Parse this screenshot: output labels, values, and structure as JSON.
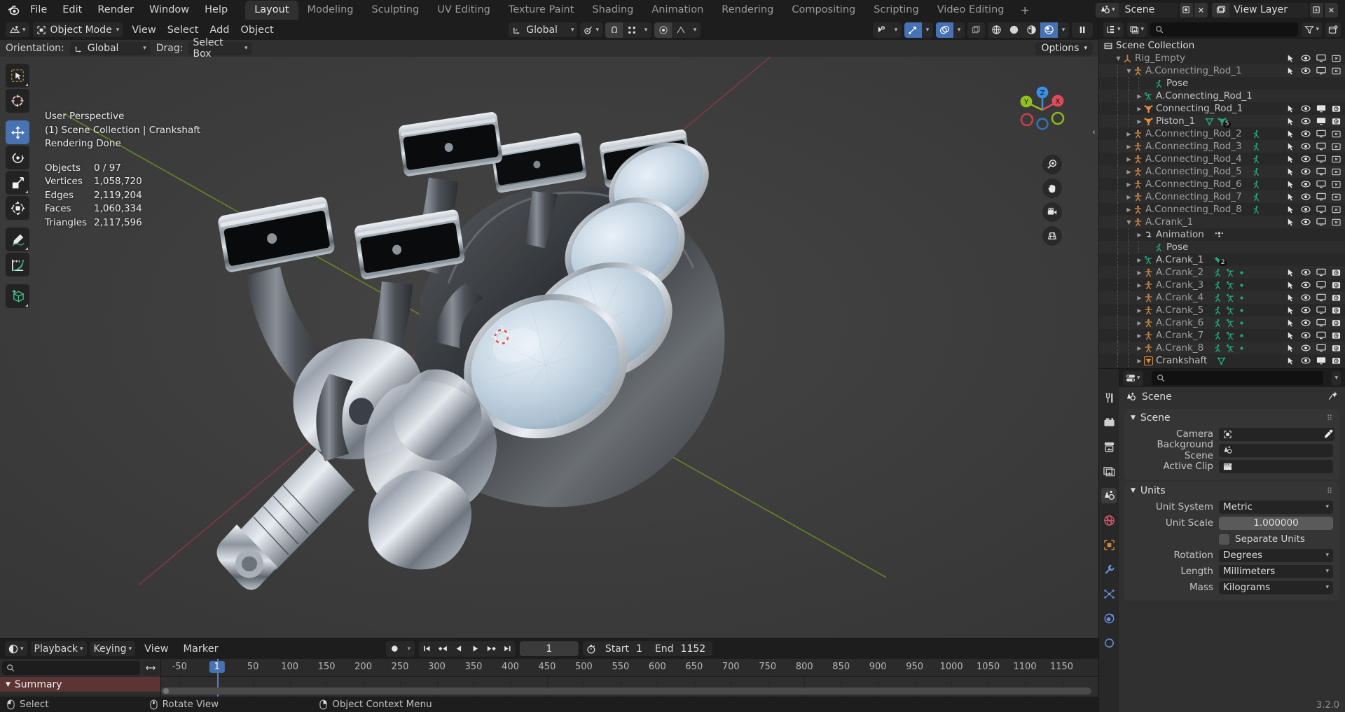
{
  "topbar": {
    "logo_icon": "blender-logo-icon",
    "menus": [
      "File",
      "Edit",
      "Render",
      "Window",
      "Help"
    ],
    "workspace_tabs": [
      {
        "label": "Layout",
        "active": true
      },
      {
        "label": "Modeling",
        "active": false
      },
      {
        "label": "Sculpting",
        "active": false
      },
      {
        "label": "UV Editing",
        "active": false
      },
      {
        "label": "Texture Paint",
        "active": false
      },
      {
        "label": "Shading",
        "active": false
      },
      {
        "label": "Animation",
        "active": false
      },
      {
        "label": "Rendering",
        "active": false
      },
      {
        "label": "Compositing",
        "active": false
      },
      {
        "label": "Scripting",
        "active": false
      },
      {
        "label": "Video Editing",
        "active": false
      }
    ],
    "add_workspace_label": "+",
    "scene_name": "Scene",
    "view_layer_name": "View Layer"
  },
  "viewport_header": {
    "editor_type_icon": "editor-type-3d-viewport-icon",
    "mode": "Object Mode",
    "menus": [
      "View",
      "Select",
      "Add",
      "Object"
    ],
    "transform_orientation": "Global",
    "snap_icon": "snap-magnet-icon",
    "proportional_icon": "proportional-edit-icon",
    "shading_modes": [
      "wireframe",
      "solid",
      "material-preview",
      "rendered"
    ],
    "active_shading": "rendered"
  },
  "tool_settings": {
    "orientation_label": "Orientation:",
    "orientation_value": "Global",
    "drag_label": "Drag:",
    "drag_value": "Select Box",
    "options_label": "Options"
  },
  "toolbar": {
    "tools": [
      {
        "name": "tweak-select-tool",
        "active": false
      },
      {
        "name": "cursor-tool",
        "active": false
      },
      {
        "name": "move-tool",
        "active": true
      },
      {
        "name": "rotate-tool",
        "active": false
      },
      {
        "name": "scale-tool",
        "active": false
      },
      {
        "name": "transform-tool",
        "active": false
      },
      {
        "name": "annotate-tool",
        "active": false
      },
      {
        "name": "measure-tool",
        "active": false
      },
      {
        "name": "add-cube-tool",
        "active": false
      }
    ]
  },
  "viewport_overlay": {
    "perspective": "User Perspective",
    "collection_line": "(1) Scene Collection | Crankshaft",
    "render_status": "Rendering Done",
    "stats": [
      {
        "label": "Objects",
        "value": "0 / 97"
      },
      {
        "label": "Vertices",
        "value": "1,058,720"
      },
      {
        "label": "Edges",
        "value": "2,119,204"
      },
      {
        "label": "Faces",
        "value": "1,060,334"
      },
      {
        "label": "Triangles",
        "value": "2,117,596"
      }
    ],
    "gizmo_axes": [
      "X",
      "Y",
      "Z"
    ],
    "nav_buttons": [
      "zoom-icon",
      "pan-hand-icon",
      "camera-view-icon",
      "toggle-perspective-icon"
    ]
  },
  "outliner": {
    "display_mode_icon": "outliner-display-mode-icon",
    "id_type_icon": "outliner-id-type-icon",
    "search_placeholder": "",
    "filter_icon": "filter-funnel-icon",
    "new_collection_icon": "new-collection-icon",
    "root": "Scene Collection",
    "rows": [
      {
        "indent": 1,
        "tri": "down",
        "icon": "empty-axes-icon",
        "icon_color": "#c08040",
        "label": "Rig_Empty",
        "dim": true,
        "rights": [
          "select",
          "eye",
          "screen",
          "render-off"
        ]
      },
      {
        "indent": 2,
        "tri": "down",
        "icon": "armature-icon",
        "icon_color": "#c08040",
        "label": "A.Connecting_Rod_1",
        "dim": true,
        "rights": [
          "select",
          "eye",
          "screen",
          "render-off"
        ]
      },
      {
        "indent": 4,
        "tri": "none",
        "icon": "pose-icon",
        "icon_color": "#1fa87a",
        "label": "Pose",
        "dim": false,
        "rights": []
      },
      {
        "indent": 3,
        "tri": "right",
        "icon": "armature-data-icon",
        "icon_color": "#1fa87a",
        "label": "A.Connecting_Rod_1",
        "dim": false,
        "rights": []
      },
      {
        "indent": 3,
        "tri": "right",
        "icon": "mesh-data-icon",
        "icon_color": "#e08a3c",
        "label": "Connecting_Rod_1",
        "dim": false,
        "rights": [
          "select",
          "eye",
          "screen-on",
          "render-on"
        ]
      },
      {
        "indent": 3,
        "tri": "right",
        "icon": "mesh-data-icon",
        "icon_color": "#e08a3c",
        "label": "Piston_1",
        "dim": false,
        "badge": "5",
        "extra_icons": [
          "mesh-triangle-icon",
          "mesh-data-icon"
        ],
        "rights": [
          "select",
          "eye",
          "screen-on",
          "render-on"
        ]
      },
      {
        "indent": 2,
        "tri": "right",
        "icon": "armature-icon",
        "icon_color": "#c08040",
        "label": "A.Connecting_Rod_2",
        "dim": true,
        "extra_icons": [
          "pose-icon"
        ],
        "rights": [
          "select",
          "eye",
          "screen",
          "render-off"
        ]
      },
      {
        "indent": 2,
        "tri": "right",
        "icon": "armature-icon",
        "icon_color": "#c08040",
        "label": "A.Connecting_Rod_3",
        "dim": true,
        "extra_icons": [
          "pose-icon"
        ],
        "rights": [
          "select",
          "eye",
          "screen",
          "render-off"
        ]
      },
      {
        "indent": 2,
        "tri": "right",
        "icon": "armature-icon",
        "icon_color": "#c08040",
        "label": "A.Connecting_Rod_4",
        "dim": true,
        "extra_icons": [
          "pose-icon"
        ],
        "rights": [
          "select",
          "eye",
          "screen",
          "render-off"
        ]
      },
      {
        "indent": 2,
        "tri": "right",
        "icon": "armature-icon",
        "icon_color": "#c08040",
        "label": "A.Connecting_Rod_5",
        "dim": true,
        "extra_icons": [
          "pose-icon"
        ],
        "rights": [
          "select",
          "eye",
          "screen",
          "render-off"
        ]
      },
      {
        "indent": 2,
        "tri": "right",
        "icon": "armature-icon",
        "icon_color": "#c08040",
        "label": "A.Connecting_Rod_6",
        "dim": true,
        "extra_icons": [
          "pose-icon"
        ],
        "rights": [
          "select",
          "eye",
          "screen",
          "render-off"
        ]
      },
      {
        "indent": 2,
        "tri": "right",
        "icon": "armature-icon",
        "icon_color": "#c08040",
        "label": "A.Connecting_Rod_7",
        "dim": true,
        "extra_icons": [
          "pose-icon"
        ],
        "rights": [
          "select",
          "eye",
          "screen",
          "render-off"
        ]
      },
      {
        "indent": 2,
        "tri": "right",
        "icon": "armature-icon",
        "icon_color": "#c08040",
        "label": "A.Connecting_Rod_8",
        "dim": true,
        "extra_icons": [
          "pose-icon"
        ],
        "rights": [
          "select",
          "eye",
          "screen",
          "render-off"
        ]
      },
      {
        "indent": 2,
        "tri": "down",
        "icon": "armature-icon",
        "icon_color": "#c08040",
        "label": "A.Crank_1",
        "dim": true,
        "rights": [
          "select",
          "eye",
          "screen",
          "render-off"
        ]
      },
      {
        "indent": 3,
        "tri": "right",
        "icon": "animation-icon",
        "icon_color": "#d5d5d5",
        "label": "Animation",
        "dim": false,
        "extra_icons": [
          "action-icon"
        ],
        "rights": []
      },
      {
        "indent": 4,
        "tri": "none",
        "icon": "pose-icon",
        "icon_color": "#1fa87a",
        "label": "Pose",
        "dim": false,
        "rights": []
      },
      {
        "indent": 3,
        "tri": "right",
        "icon": "armature-data-icon",
        "icon_color": "#1fa87a",
        "label": "A.Crank_1",
        "dim": false,
        "badge": "2",
        "extra_icons": [
          "bone-icon"
        ],
        "rights": []
      },
      {
        "indent": 3,
        "tri": "right",
        "icon": "armature-icon",
        "icon_color": "#c08040",
        "label": "A.Crank_2",
        "dim": true,
        "extra_icons": [
          "pose-icon",
          "armature-data-icon",
          "dot-icon"
        ],
        "rights": [
          "select",
          "eye",
          "screen",
          "render-on"
        ]
      },
      {
        "indent": 3,
        "tri": "right",
        "icon": "armature-icon",
        "icon_color": "#c08040",
        "label": "A.Crank_3",
        "dim": true,
        "extra_icons": [
          "pose-icon",
          "armature-data-icon",
          "dot-icon"
        ],
        "rights": [
          "select",
          "eye",
          "screen",
          "render-on"
        ]
      },
      {
        "indent": 3,
        "tri": "right",
        "icon": "armature-icon",
        "icon_color": "#c08040",
        "label": "A.Crank_4",
        "dim": true,
        "extra_icons": [
          "pose-icon",
          "armature-data-icon",
          "dot-icon"
        ],
        "rights": [
          "select",
          "eye",
          "screen",
          "render-on"
        ]
      },
      {
        "indent": 3,
        "tri": "right",
        "icon": "armature-icon",
        "icon_color": "#c08040",
        "label": "A.Crank_5",
        "dim": true,
        "extra_icons": [
          "pose-icon",
          "armature-data-icon",
          "dot-icon"
        ],
        "rights": [
          "select",
          "eye",
          "screen",
          "render-on"
        ]
      },
      {
        "indent": 3,
        "tri": "right",
        "icon": "armature-icon",
        "icon_color": "#c08040",
        "label": "A.Crank_6",
        "dim": true,
        "extra_icons": [
          "pose-icon",
          "armature-data-icon",
          "dot-icon"
        ],
        "rights": [
          "select",
          "eye",
          "screen",
          "render-on"
        ]
      },
      {
        "indent": 3,
        "tri": "right",
        "icon": "armature-icon",
        "icon_color": "#c08040",
        "label": "A.Crank_7",
        "dim": true,
        "extra_icons": [
          "pose-icon",
          "armature-data-icon",
          "dot-icon"
        ],
        "rights": [
          "select",
          "eye",
          "screen",
          "render-on"
        ]
      },
      {
        "indent": 3,
        "tri": "right",
        "icon": "armature-icon",
        "icon_color": "#c08040",
        "label": "A.Crank_8",
        "dim": true,
        "extra_icons": [
          "pose-icon",
          "armature-data-icon",
          "dot-icon"
        ],
        "rights": [
          "select",
          "eye",
          "screen",
          "render-on"
        ]
      },
      {
        "indent": 3,
        "tri": "right",
        "icon": "mesh-sel-icon",
        "icon_color": "#e08a3c",
        "label": "Crankshaft",
        "dim": false,
        "extra_icons": [
          "mesh-triangle-icon"
        ],
        "rights": [
          "select",
          "eye",
          "screen-on",
          "render-on"
        ]
      }
    ]
  },
  "properties": {
    "tabs": [
      {
        "name": "tool-tab",
        "icon": "wrench-screwdriver-icon",
        "active": false
      },
      {
        "name": "render-tab",
        "icon": "camera-back-icon",
        "active": false
      },
      {
        "name": "output-tab",
        "icon": "printer-icon",
        "active": false
      },
      {
        "name": "viewlayer-tab",
        "icon": "images-icon",
        "active": false
      },
      {
        "name": "scene-tab",
        "icon": "scene-cone-icon",
        "active": true
      },
      {
        "name": "world-tab",
        "icon": "world-globe-icon",
        "active": false
      },
      {
        "name": "object-tab",
        "icon": "object-square-icon",
        "active": false
      },
      {
        "name": "modifier-tab",
        "icon": "wrench-icon",
        "active": false
      },
      {
        "name": "particles-tab",
        "icon": "particles-icon",
        "active": false
      },
      {
        "name": "physics-tab",
        "icon": "physics-orbit-icon",
        "active": false
      },
      {
        "name": "constraints-tab",
        "icon": "constraint-icon",
        "active": false
      }
    ],
    "breadcrumb": "Scene",
    "search_placeholder": "",
    "panels": [
      {
        "title": "Scene",
        "fields": [
          {
            "label": "Camera",
            "value": "",
            "icon": "camera-object-icon",
            "type": "id",
            "eyedropper": true
          },
          {
            "label": "Background Scene",
            "value": "",
            "icon": "scene-cone-icon",
            "type": "id",
            "eyedropper": false
          },
          {
            "label": "Active Clip",
            "value": "",
            "icon": "movie-clip-icon",
            "type": "id",
            "eyedropper": false
          }
        ]
      },
      {
        "title": "Units",
        "fields": [
          {
            "label": "Unit System",
            "value": "Metric",
            "type": "dropdown"
          },
          {
            "label": "Unit Scale",
            "value": "1.000000",
            "type": "slider"
          },
          {
            "label": "Separate Units",
            "value": "",
            "type": "checkbox",
            "checked": false
          },
          {
            "label": "Rotation",
            "value": "Degrees",
            "type": "dropdown"
          },
          {
            "label": "Length",
            "value": "Millimeters",
            "type": "dropdown"
          },
          {
            "label": "Mass",
            "value": "Kilograms",
            "type": "dropdown"
          }
        ]
      }
    ]
  },
  "timeline": {
    "editor_icon": "timeline-editor-icon",
    "menus": [
      "Playback",
      "Keying",
      "View",
      "Marker"
    ],
    "record_icon": "auto-keying-record-icon",
    "transport": [
      "jump-to-start",
      "jump-prev-keyframe",
      "play-reverse",
      "play",
      "jump-next-keyframe",
      "jump-to-end"
    ],
    "current_frame": "1",
    "start_label": "Start",
    "start_value": "1",
    "end_label": "End",
    "end_value": "1152",
    "use_preview_range_icon": "stopwatch-icon",
    "search_placeholder": "",
    "summary_label": "Summary",
    "ticks": [
      "-50",
      "1",
      "50",
      "100",
      "150",
      "200",
      "250",
      "300",
      "350",
      "400",
      "450",
      "500",
      "550",
      "600",
      "650",
      "700",
      "750",
      "800",
      "850",
      "900",
      "950",
      "1000",
      "1050",
      "1100",
      "1150"
    ],
    "playhead_frame": "1"
  },
  "statusbar": {
    "items": [
      {
        "icon": "mouse-left-icon",
        "label": "Select"
      },
      {
        "icon": "mouse-middle-icon",
        "label": "Rotate View"
      },
      {
        "icon": "mouse-right-icon",
        "label": "Object Context Menu"
      }
    ],
    "version": "3.2.0"
  },
  "colors": {
    "accent_blue": "#4772b3",
    "panel_bg": "#303030",
    "viewport_bg": "#3d3d3d",
    "header_bg": "#1d1d1d",
    "outliner_bg": "#282828",
    "armature_orange": "#c08040",
    "mesh_orange": "#e08a3c",
    "pose_green": "#1fa87a",
    "summary_red": "#5c3434",
    "axis_x": "#e04a5a",
    "axis_y": "#90c020",
    "axis_z": "#3a8fe0"
  }
}
